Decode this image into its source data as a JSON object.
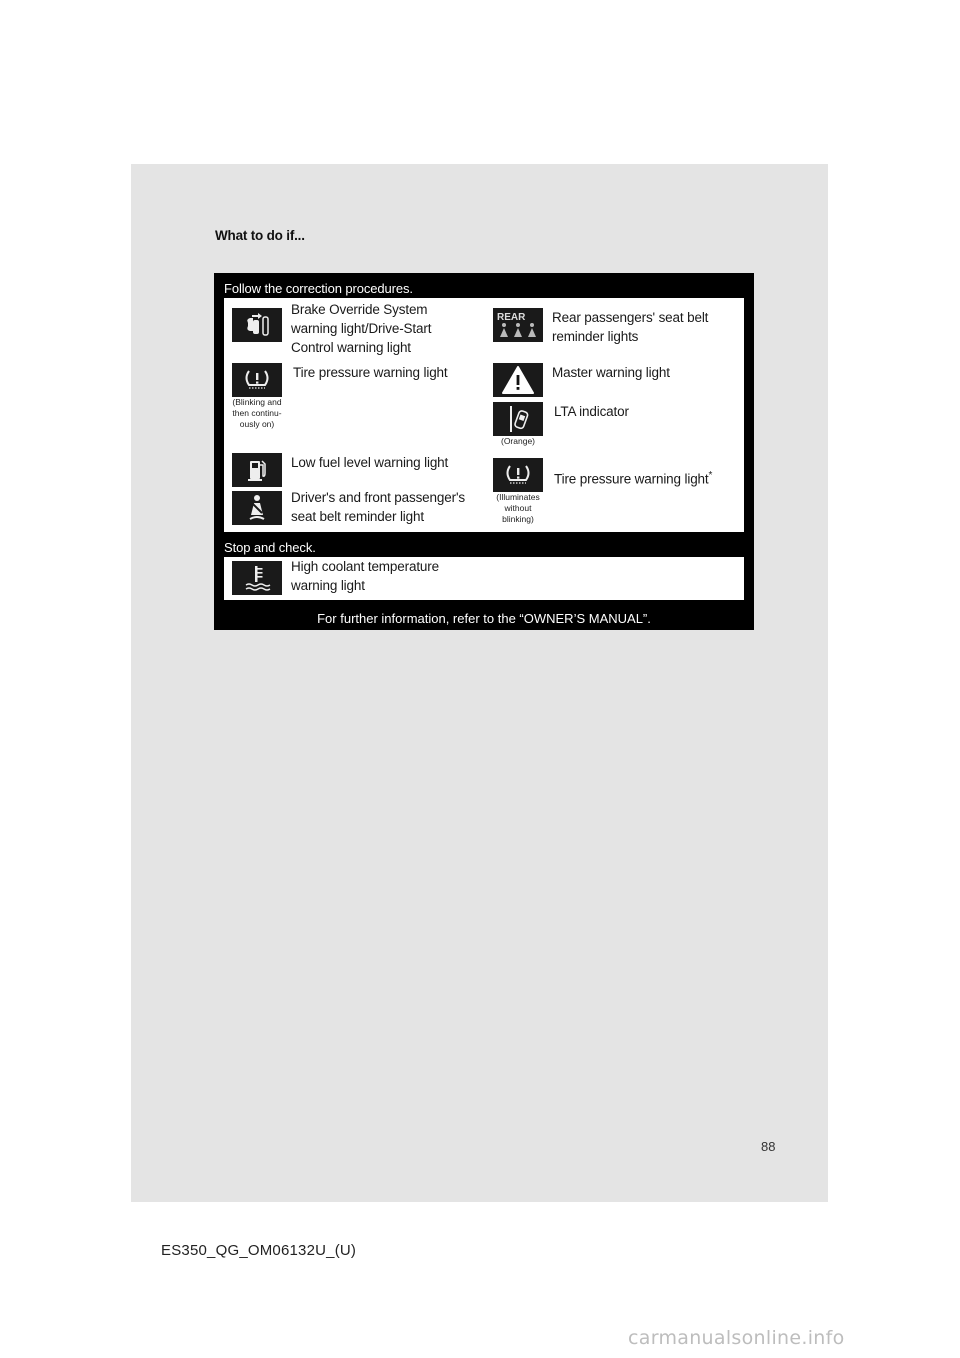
{
  "section_title": "What to do if...",
  "panel": {
    "correction_heading": "Follow the correction procedures.",
    "correction_items": [
      {
        "icon": "brake-override-icon",
        "label": "Brake Override System warning light/Drive-Start Control warning light",
        "note": ""
      },
      {
        "icon": "rear-seatbelt-icon",
        "label": "Rear passengers' seat belt reminder lights",
        "note": ""
      },
      {
        "icon": "tire-pressure-icon",
        "label": "Tire pressure warning light",
        "note": "(Blinking and then continu-ously on)"
      },
      {
        "icon": "master-warning-icon",
        "label": "Master warning light",
        "note": ""
      },
      {
        "icon": "lta-icon",
        "label": "LTA indicator",
        "note": "(Orange)"
      },
      {
        "icon": "low-fuel-icon",
        "label": "Low fuel level warning light",
        "note": ""
      },
      {
        "icon": "tire-pressure-icon",
        "label": "Tire pressure warning light",
        "sup": "*",
        "note": "(Illuminates without blinking)"
      },
      {
        "icon": "seatbelt-icon",
        "label": "Driver's and front passenger's seat belt reminder light",
        "note": ""
      }
    ],
    "stop_heading": "Stop and check.",
    "stop_items": [
      {
        "icon": "coolant-temp-icon",
        "label": "High coolant temperature warning light",
        "note": ""
      }
    ],
    "footer": "For further information, refer to the “OWNER’S MANUAL”."
  },
  "page_number": "88",
  "document_code": "ES350_QG_OM06132U_(U)",
  "watermark": "carmanualsonline.info"
}
